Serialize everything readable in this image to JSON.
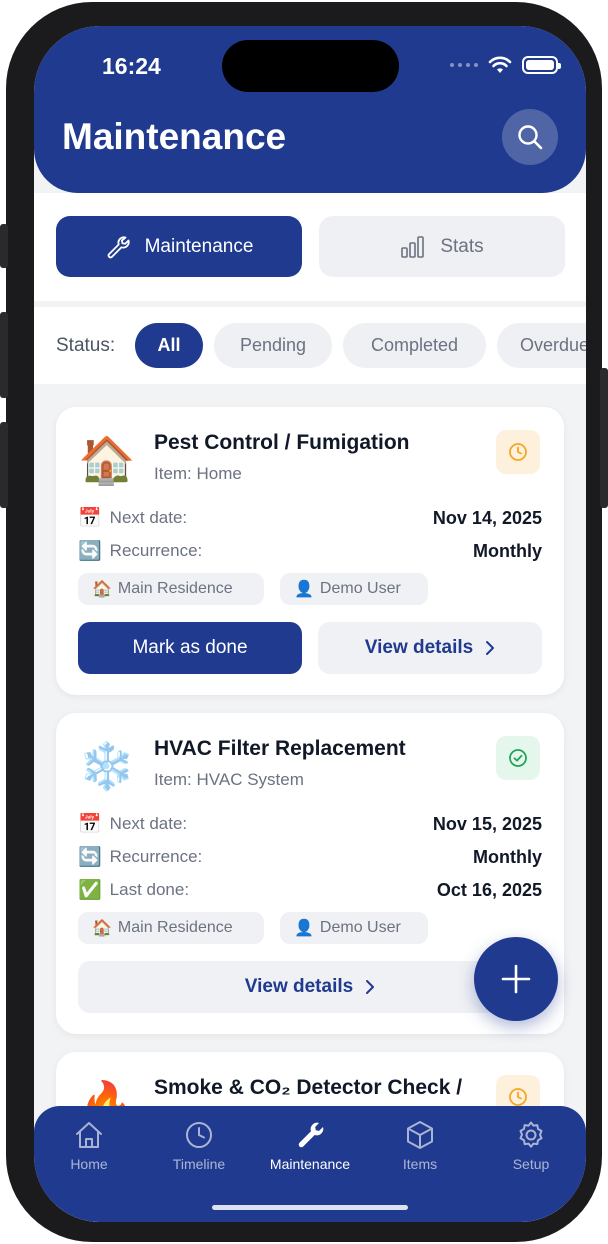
{
  "status_bar": {
    "time": "16:24"
  },
  "header": {
    "title": "Maintenance"
  },
  "segments": {
    "maintenance": "Maintenance",
    "stats": "Stats"
  },
  "filters": {
    "label": "Status:",
    "options": [
      "All",
      "Pending",
      "Completed",
      "Overdue"
    ],
    "selected": "All"
  },
  "cards": [
    {
      "emoji": "🏠",
      "title": "Pest Control / Fumigation",
      "subtitle": "Item: Home",
      "status": "pending",
      "rows": [
        {
          "emoji": "📅",
          "label": "Next date:",
          "value": "Nov 14, 2025"
        },
        {
          "emoji": "🔄",
          "label": "Recurrence:",
          "value": "Monthly"
        }
      ],
      "tags": [
        {
          "emoji": "🏠",
          "text": "Main Residence"
        },
        {
          "emoji": "👤",
          "text": "Demo User"
        }
      ],
      "primary_action": "Mark as done",
      "secondary_action": "View details"
    },
    {
      "emoji": "❄️",
      "title": "HVAC Filter Replacement",
      "subtitle": "Item: HVAC System",
      "status": "completed",
      "rows": [
        {
          "emoji": "📅",
          "label": "Next date:",
          "value": "Nov 15, 2025"
        },
        {
          "emoji": "🔄",
          "label": "Recurrence:",
          "value": "Monthly"
        },
        {
          "emoji": "✅",
          "label": "Last done:",
          "value": "Oct 16, 2025"
        }
      ],
      "tags": [
        {
          "emoji": "🏠",
          "text": "Main Residence"
        },
        {
          "emoji": "👤",
          "text": "Demo User"
        }
      ],
      "secondary_action": "View details"
    },
    {
      "emoji": "🔥",
      "title": "Smoke & CO₂ Detector Check /",
      "status": "pending"
    }
  ],
  "tabbar": {
    "items": [
      {
        "label": "Home",
        "icon": "home-icon"
      },
      {
        "label": "Timeline",
        "icon": "clock-icon"
      },
      {
        "label": "Maintenance",
        "icon": "wrench-icon"
      },
      {
        "label": "Items",
        "icon": "box-icon"
      },
      {
        "label": "Setup",
        "icon": "gear-icon"
      }
    ],
    "active": "Maintenance"
  },
  "colors": {
    "primary": "#1f3a8e",
    "pending": "#f5a623",
    "completed": "#22a35a",
    "background": "#f2f3f5"
  }
}
